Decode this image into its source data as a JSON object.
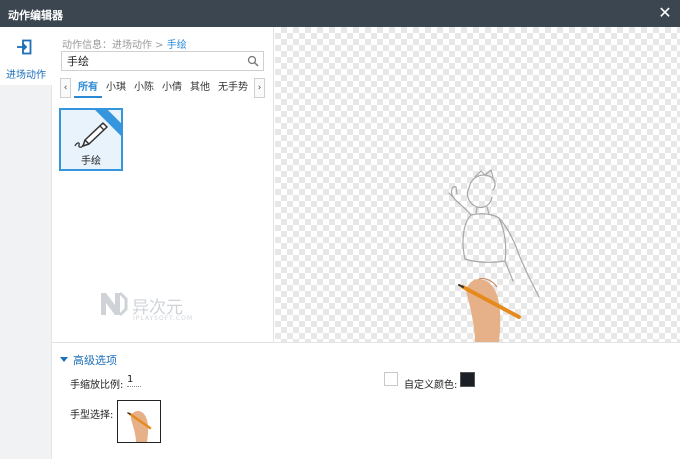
{
  "window": {
    "title": "动作编辑器"
  },
  "nav": {
    "entrance_label": "进场动作"
  },
  "breadcrumb": {
    "root": "动作信息：进场动作 >",
    "current": "手绘"
  },
  "search": {
    "value": "手绘"
  },
  "tabs": [
    "所有",
    "小琪",
    "小陈",
    "小倩",
    "其他",
    "无手势"
  ],
  "card": {
    "name": "手绘"
  },
  "watermark": {
    "brand": "异次元",
    "sub": "IPLAYSOFT.COM"
  },
  "advanced": {
    "title": "高级选项",
    "scale_label": "手缩放比例:",
    "scale_value": "1",
    "color_label": "自定义颜色:",
    "color_value": "#1a2026",
    "hand_label": "手型选择:"
  },
  "colors": {
    "accent": "#2a8ad5",
    "titlebar": "#3b4650"
  }
}
